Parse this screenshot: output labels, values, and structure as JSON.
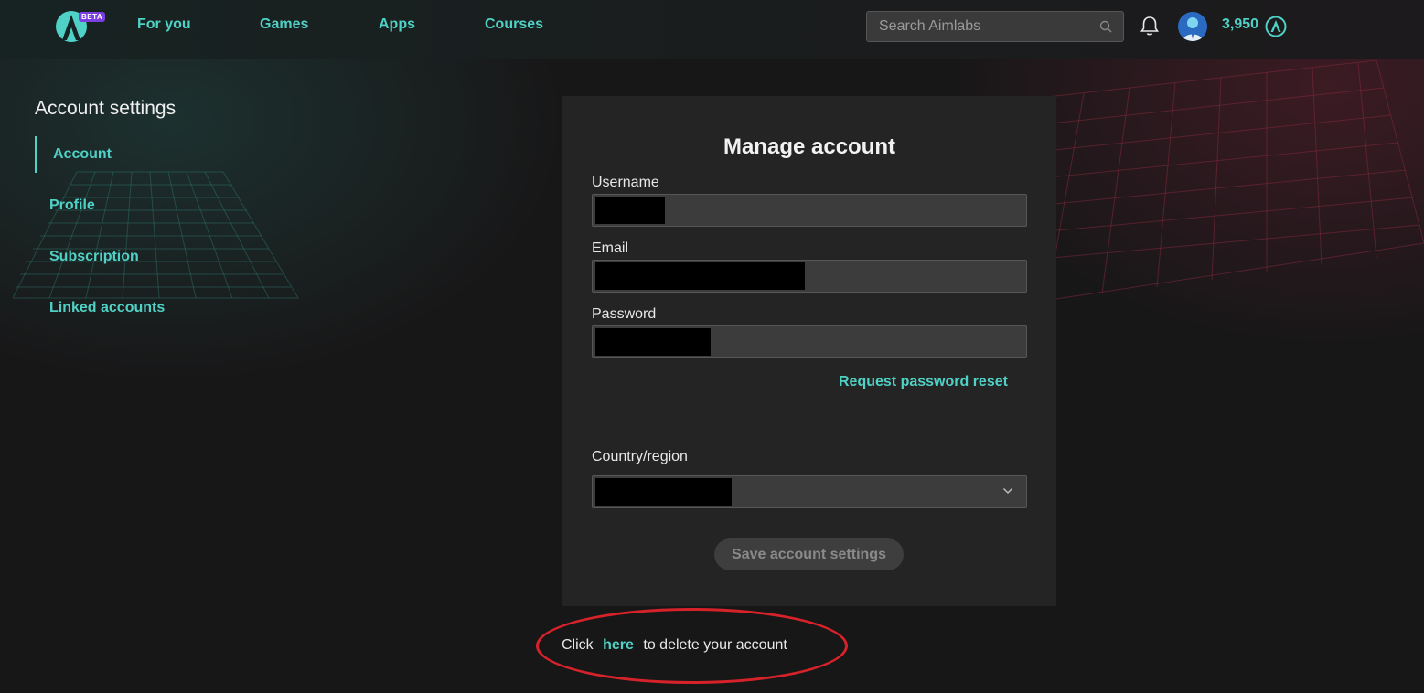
{
  "topbar": {
    "beta_badge": "BETA",
    "nav": [
      {
        "label": "For you"
      },
      {
        "label": "Games"
      },
      {
        "label": "Apps"
      },
      {
        "label": "Courses"
      }
    ],
    "search_placeholder": "Search Aimlabs",
    "points": "3,950"
  },
  "sidebar": {
    "title": "Account settings",
    "items": [
      {
        "label": "Account",
        "active": true
      },
      {
        "label": "Profile"
      },
      {
        "label": "Subscription"
      },
      {
        "label": "Linked accounts"
      }
    ]
  },
  "card": {
    "title": "Manage account",
    "username_label": "Username",
    "email_label": "Email",
    "password_label": "Password",
    "reset_link": "Request password reset",
    "country_label": "Country/region",
    "save_button": "Save account settings"
  },
  "delete": {
    "prefix": "Click",
    "link": "here",
    "suffix": "to delete your account"
  },
  "colors": {
    "accent": "#4fd1c5",
    "background": "#181718",
    "card": "#242424",
    "annotation": "#d8222a",
    "beta": "#7b3fe4"
  },
  "icons": [
    "aimlabs-logo-icon",
    "search-icon",
    "bell-icon",
    "avatar",
    "points-icon",
    "chevron-down-icon"
  ]
}
